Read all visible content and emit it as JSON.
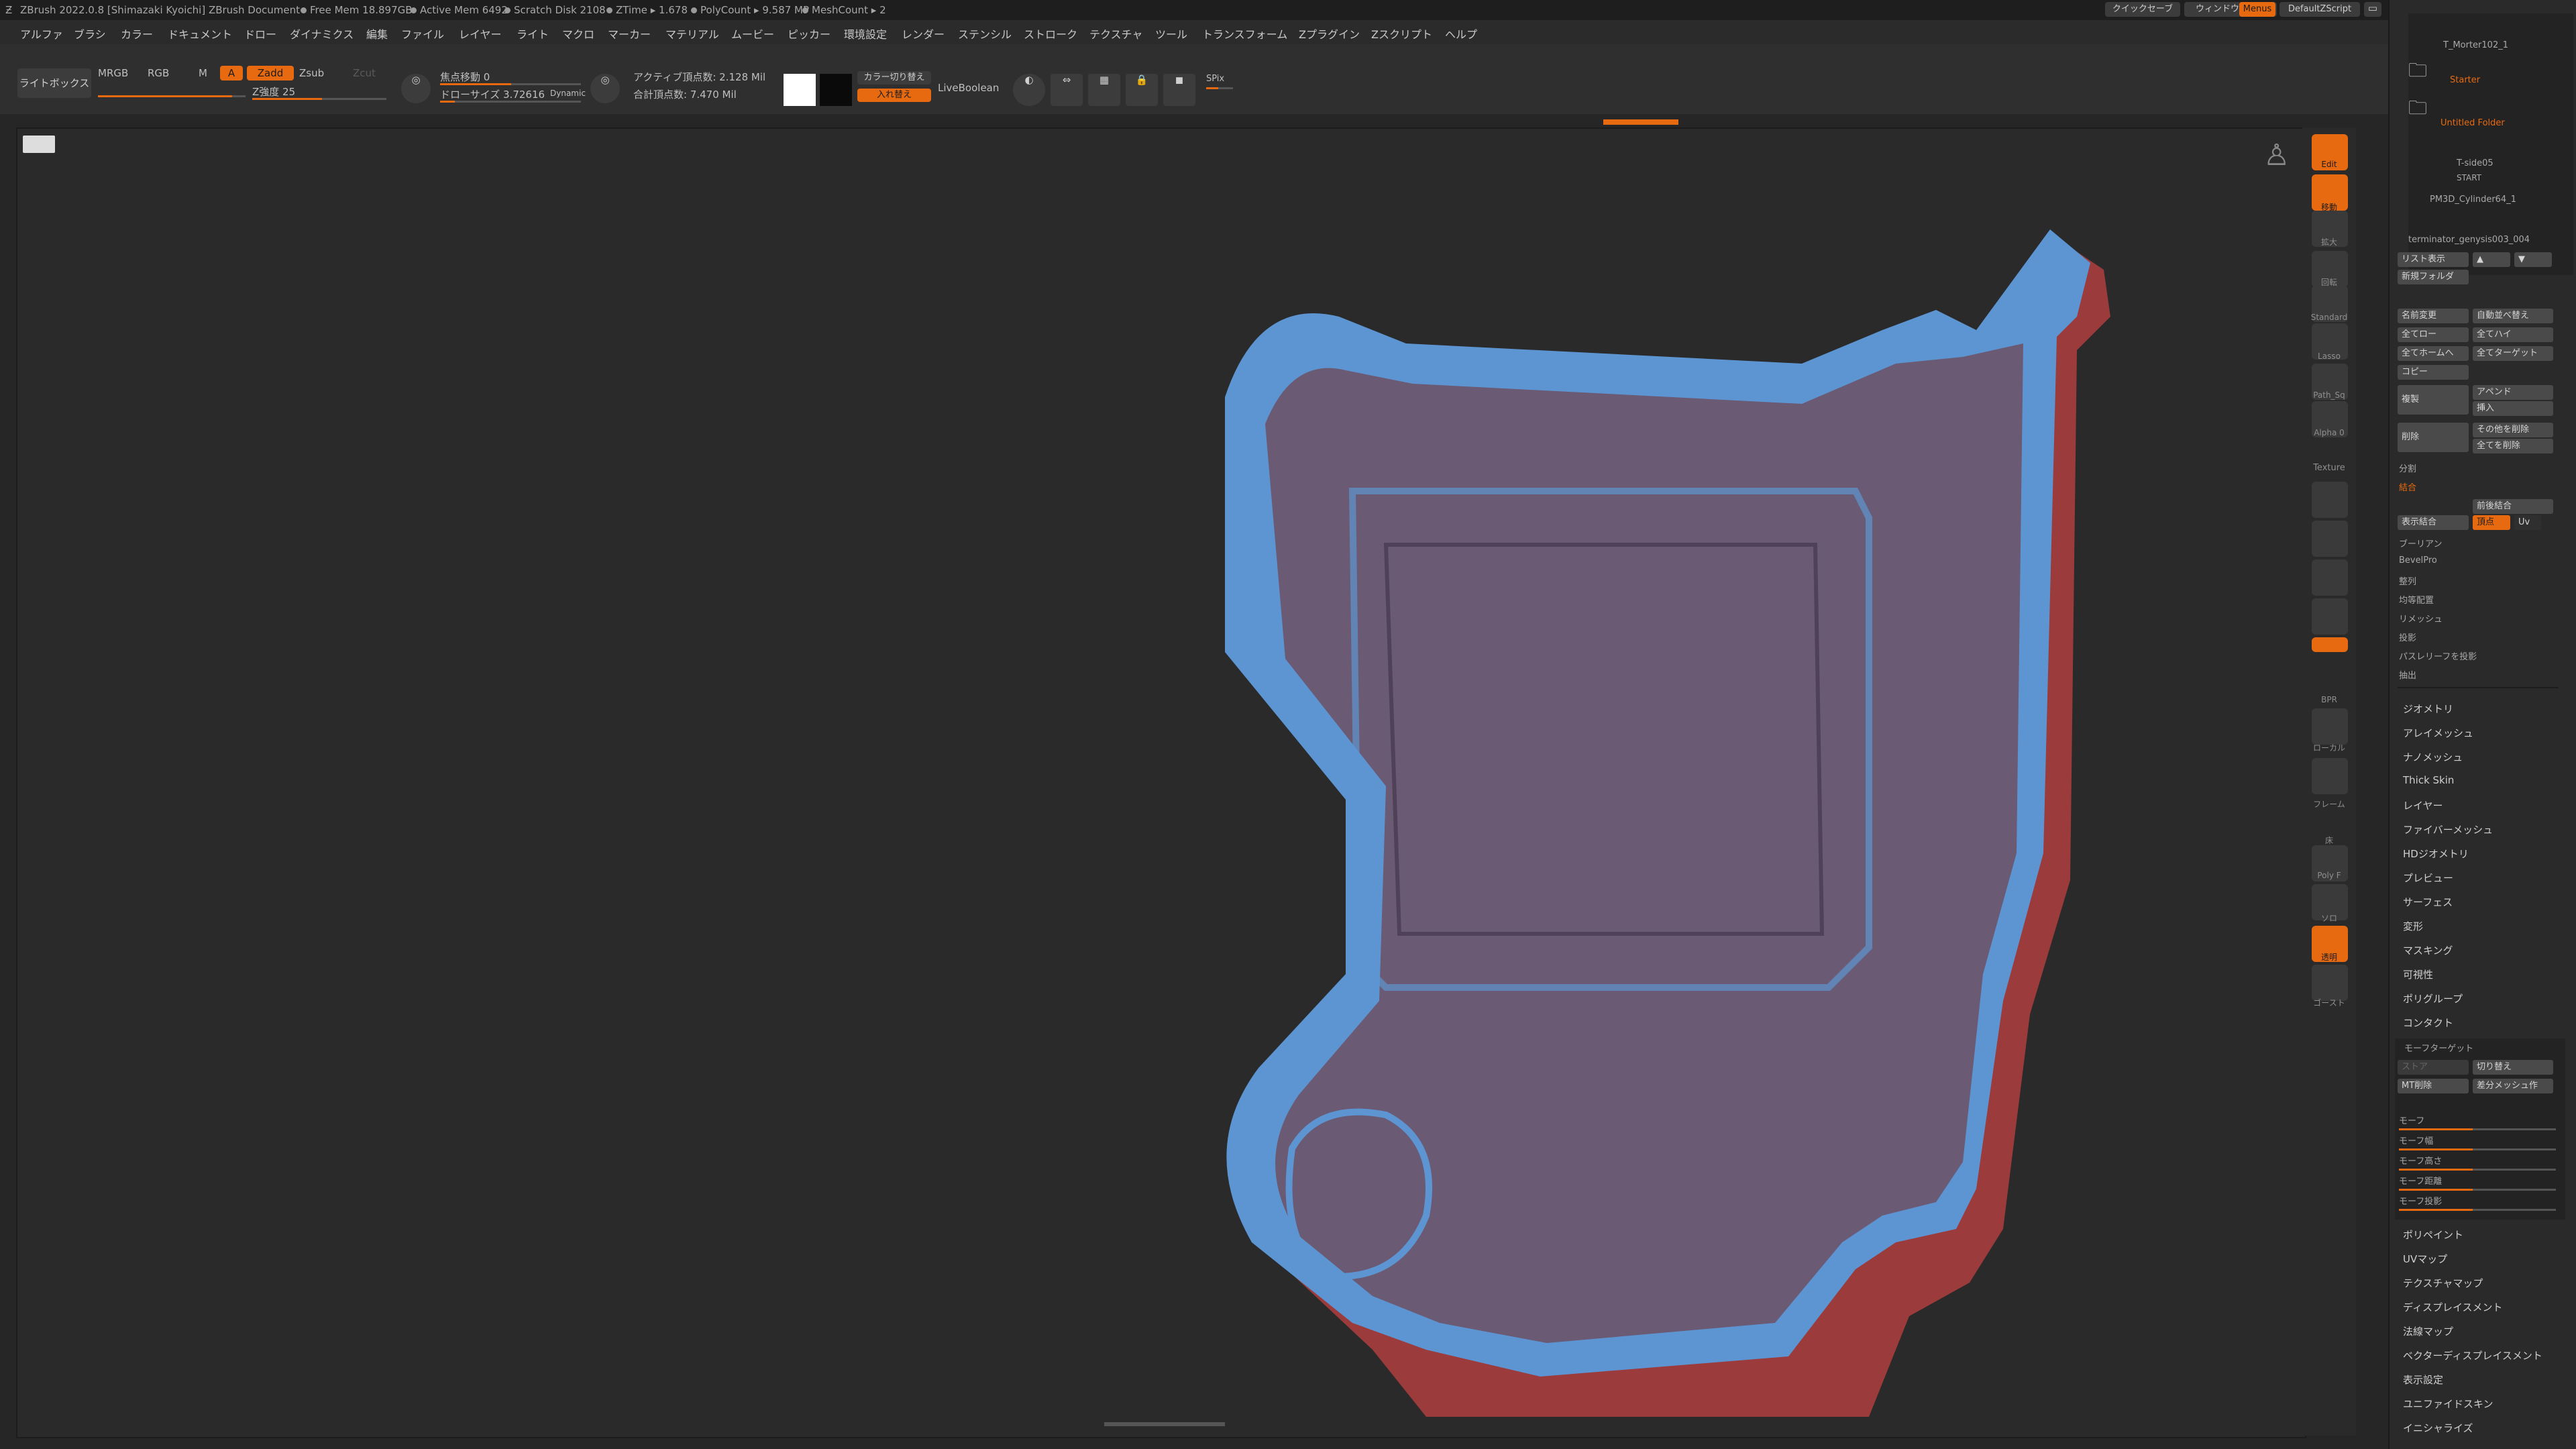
{
  "titlebar": {
    "app": "ZBrush 2022.0.8 [Shimazaki Kyoichi]  ZBrush Document",
    "free_mem": "Free Mem 18.897GB",
    "active_mem": "Active Mem 6492",
    "scratch": "Scratch Disk 2108",
    "ztime": "ZTime ▸ 1.678",
    "polycount": "PolyCount ▸ 9.587 MP",
    "meshcount": "MeshCount ▸ 2",
    "quicksave": "クイックセーブ",
    "window_transparency": "ウィンドウ透明度",
    "menus": "Menus",
    "default_script": "DefaultZScript"
  },
  "menu": [
    "アルファ",
    "ブラシ",
    "カラー",
    "ドキュメント",
    "ドロー",
    "ダイナミクス",
    "編集",
    "ファイル",
    "レイヤー",
    "ライト",
    "マクロ",
    "マーカー",
    "マテリアル",
    "ムービー",
    "ピッカー",
    "環境設定",
    "レンダー",
    "ステンシル",
    "ストローク",
    "テクスチャ",
    "ツール",
    "トランスフォーム",
    "Zプラグイン",
    "Zスクリプト",
    "ヘルプ"
  ],
  "shelf": {
    "lightbox": "ライトボックス",
    "mrgb": "MRGB",
    "rgb": "RGB",
    "m": "M",
    "a": "A",
    "zadd": "Zadd",
    "zsub": "Zsub",
    "zcut": "Zcut",
    "intensity": "Z強度 25",
    "focal": "焦点移動 0",
    "draw_size": "ドローサイズ 3.72616",
    "dynamic": "Dynamic",
    "active_points": "アクティブ頂点数: 2.128 Mil",
    "total_points": "合計頂点数: 7.470 Mil",
    "color_switch": "カラー切り替え",
    "swap": "入れ替え",
    "liveboolean": "LiveBoolean",
    "spix": "SPix"
  },
  "right_shelf": [
    "Edit",
    "移動",
    "拡大",
    "回転",
    "Standard",
    "Lasso",
    "Path_Sq",
    "Alpha 0",
    "Texture",
    "BPR",
    "ローカル",
    "フレーム",
    "床",
    "Poly F",
    "ソロ",
    "透明",
    "ゴースト"
  ],
  "panel": {
    "subtools": [
      "T_Morter102_1",
      "Starter",
      "Untitled Folder",
      "T-side05",
      "START",
      "PM3D_Cylinder64_1",
      "terminator_genysis003_004"
    ],
    "buttons": [
      "リスト表示",
      "新規フォルダ",
      "名前変更",
      "自動並べ替え",
      "全てロー",
      "全てハイ",
      "全てホームへ",
      "全てターゲット",
      "コピー",
      "複製",
      "アペンド",
      "挿入",
      "削除",
      "その他を削除",
      "全てを削除",
      "分割",
      "結合",
      "表示結合",
      "前後結合",
      "頂点",
      "Uv",
      "ブーリアン",
      "BevelPro",
      "整列",
      "均等配置",
      "リメッシュ",
      "投影",
      "パスレリーフを投影",
      "抽出"
    ],
    "sections": [
      "ジオメトリ",
      "アレイメッシュ",
      "ナノメッシュ",
      "Thick Skin",
      "レイヤー",
      "ファイバーメッシュ",
      "HDジオメトリ",
      "プレビュー",
      "サーフェス",
      "変形",
      "マスキング",
      "可視性",
      "ポリグループ",
      "コンタクト"
    ],
    "morph_title": "モーフターゲット",
    "morph_buttons": [
      "ストア",
      "切り替え",
      "MT削除",
      "差分メッシュ作"
    ],
    "morph_sliders": [
      "モーフ",
      "モーフ幅",
      "モーフ高さ",
      "モーフ距離",
      "モーフ投影"
    ],
    "sections2": [
      "ポリペイント",
      "UVマップ",
      "テクスチャマップ",
      "ディスプレイスメント",
      "法線マップ",
      "ベクターディスプレイスメント",
      "表示設定",
      "ユニファイドスキン",
      "イニシャライズ"
    ]
  },
  "colors": {
    "accent": "#e86a10",
    "mesh_blue": "#5d95d2",
    "mesh_red": "#9b3b3b",
    "mesh_purple": "#6b5a73"
  }
}
